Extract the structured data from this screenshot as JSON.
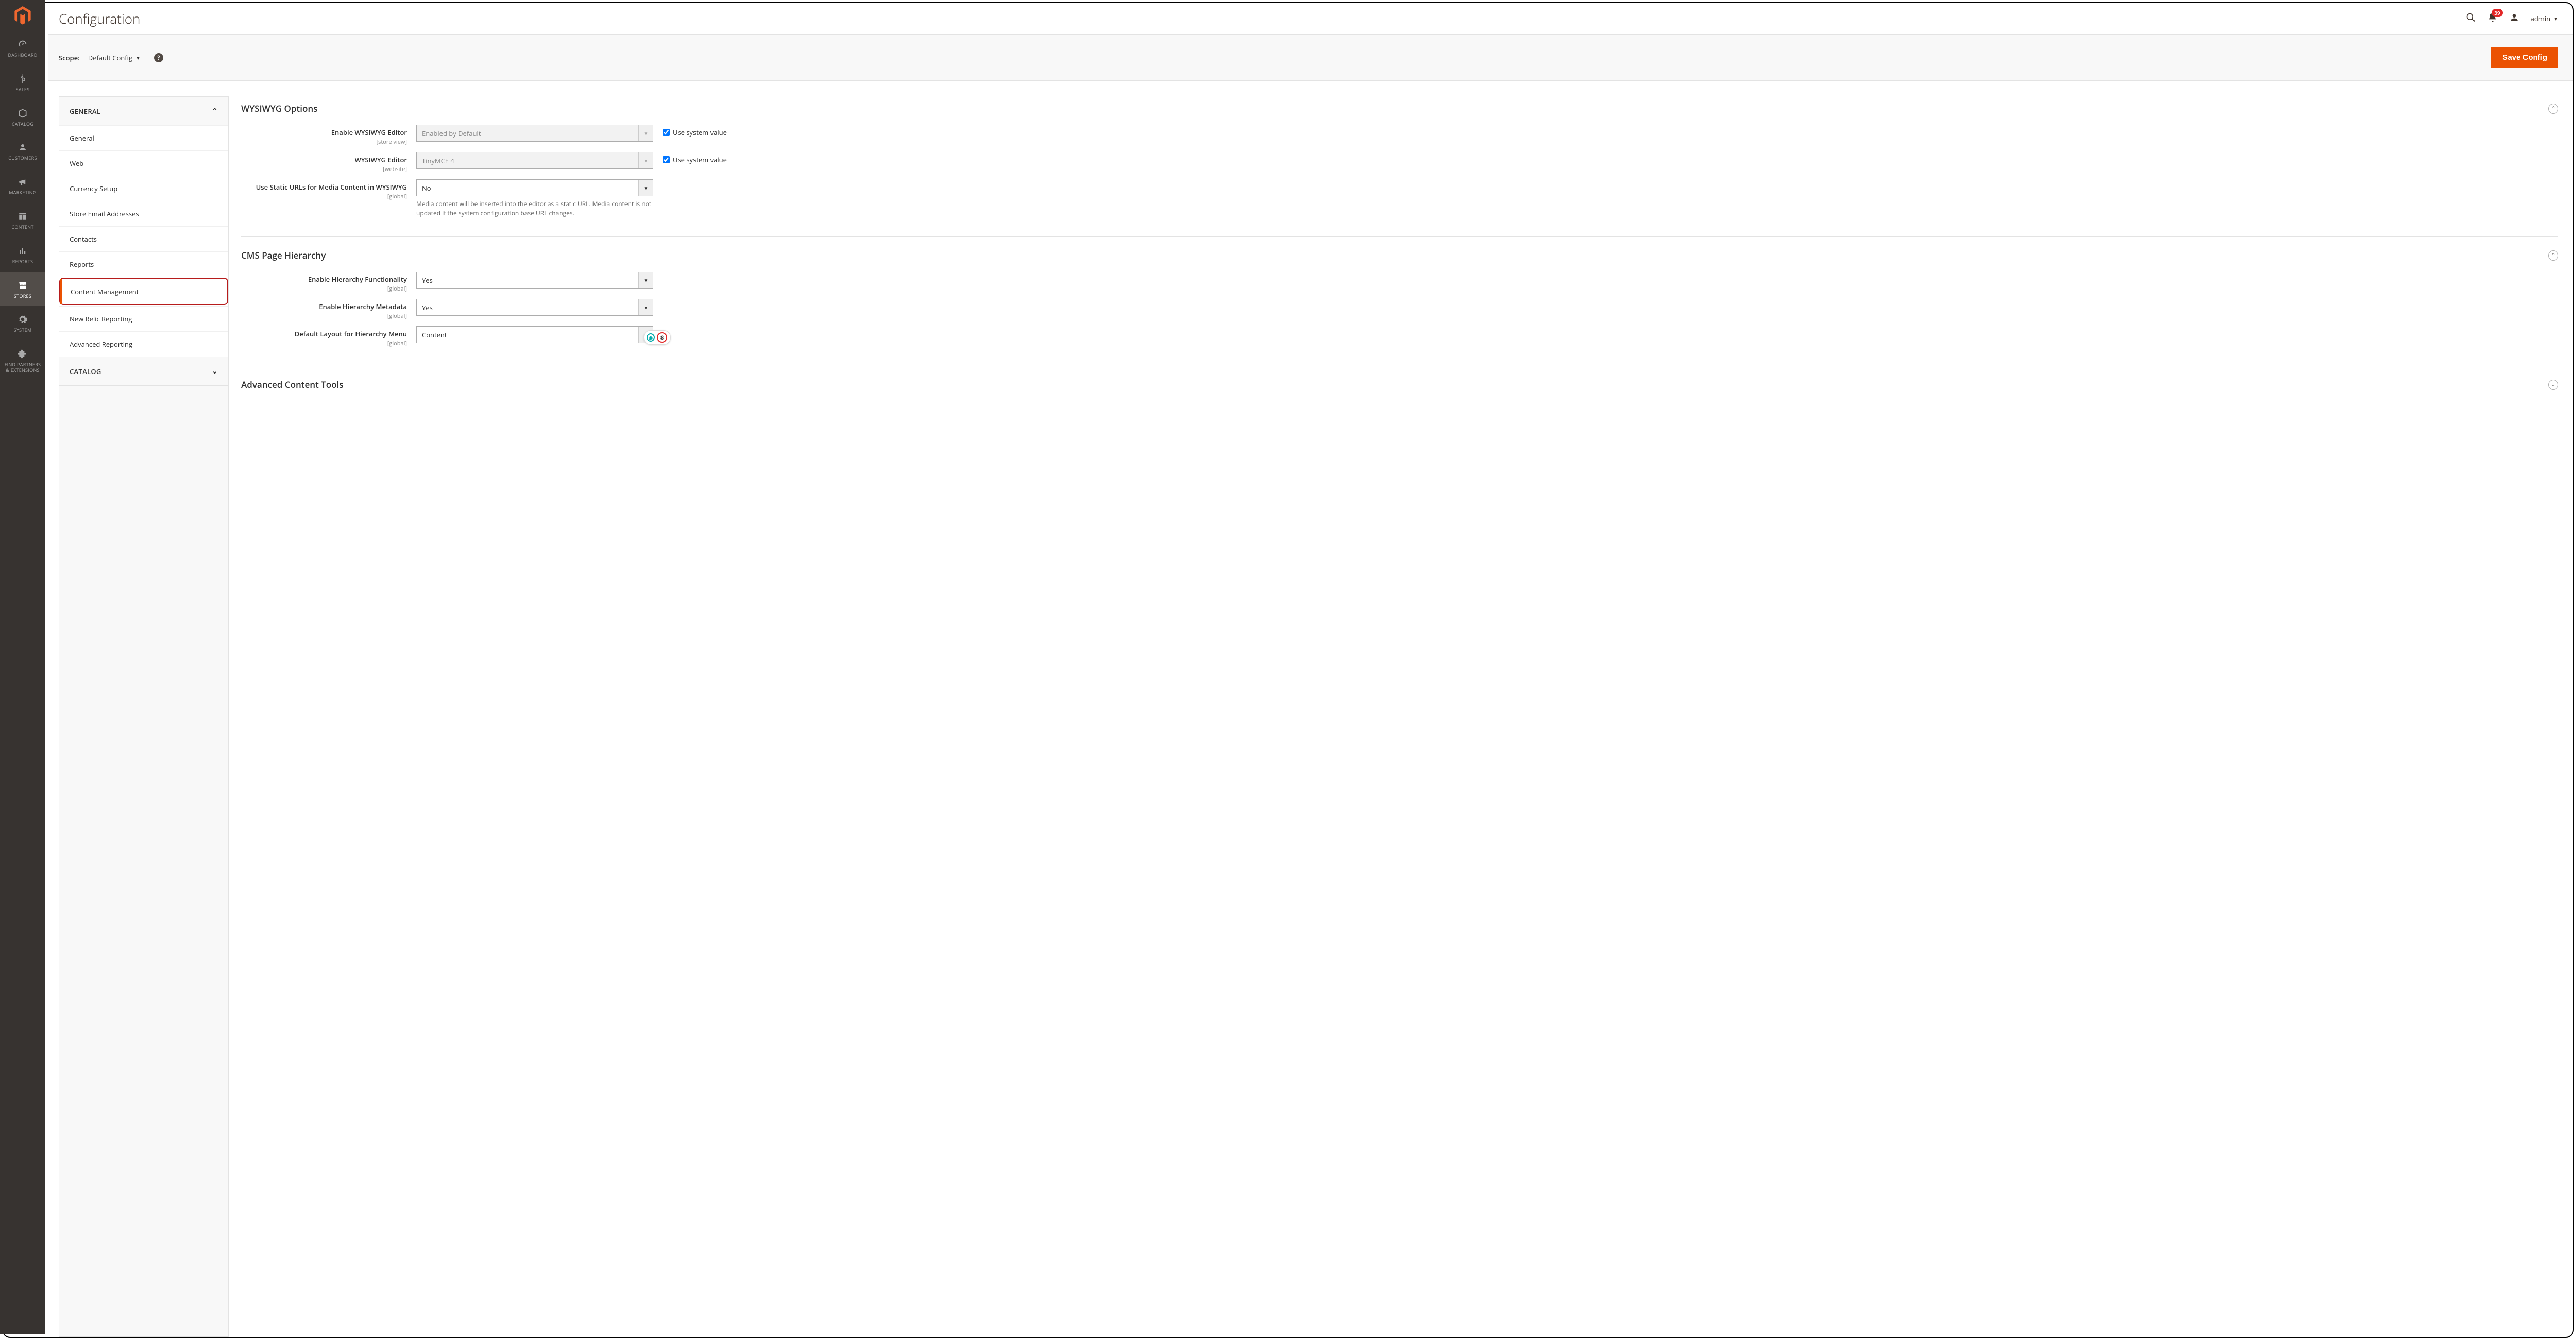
{
  "page": {
    "title": "Configuration"
  },
  "header": {
    "notifications_count": "39",
    "user_label": "admin"
  },
  "scope": {
    "label": "Scope:",
    "value": "Default Config",
    "save_label": "Save Config"
  },
  "sidebar": {
    "items": [
      {
        "label": "DASHBOARD"
      },
      {
        "label": "SALES"
      },
      {
        "label": "CATALOG"
      },
      {
        "label": "CUSTOMERS"
      },
      {
        "label": "MARKETING"
      },
      {
        "label": "CONTENT"
      },
      {
        "label": "REPORTS"
      },
      {
        "label": "STORES"
      },
      {
        "label": "SYSTEM"
      },
      {
        "label": "FIND PARTNERS & EXTENSIONS"
      }
    ]
  },
  "config_nav": {
    "groups": [
      {
        "label": "GENERAL",
        "expanded": true,
        "items": [
          {
            "label": "General"
          },
          {
            "label": "Web"
          },
          {
            "label": "Currency Setup"
          },
          {
            "label": "Store Email Addresses"
          },
          {
            "label": "Contacts"
          },
          {
            "label": "Reports"
          },
          {
            "label": "Content Management",
            "selected": true,
            "highlighted": true
          },
          {
            "label": "New Relic Reporting"
          },
          {
            "label": "Advanced Reporting"
          }
        ]
      },
      {
        "label": "CATALOG",
        "expanded": false
      }
    ]
  },
  "sections": {
    "wysiwyg": {
      "title": "WYSIWYG Options",
      "fields": {
        "enable": {
          "label": "Enable WYSIWYG Editor",
          "scope": "[store view]",
          "value": "Enabled by Default",
          "system_label": "Use system value"
        },
        "editor": {
          "label": "WYSIWYG Editor",
          "scope": "[website]",
          "value": "TinyMCE 4",
          "system_label": "Use system value"
        },
        "static_urls": {
          "label": "Use Static URLs for Media Content in WYSIWYG",
          "scope": "[global]",
          "value": "No",
          "note": "Media content will be inserted into the editor as a static URL. Media content is not updated if the system configuration base URL changes."
        }
      }
    },
    "hierarchy": {
      "title": "CMS Page Hierarchy",
      "fields": {
        "enable_func": {
          "label": "Enable Hierarchy Functionality",
          "scope": "[global]",
          "value": "Yes"
        },
        "enable_meta": {
          "label": "Enable Hierarchy Metadata",
          "scope": "[global]",
          "value": "Yes"
        },
        "default_layout": {
          "label": "Default Layout for Hierarchy Menu",
          "scope": "[global]",
          "value": "Content"
        }
      }
    },
    "advanced": {
      "title": "Advanced Content Tools"
    }
  },
  "widget": {
    "count": "8"
  }
}
